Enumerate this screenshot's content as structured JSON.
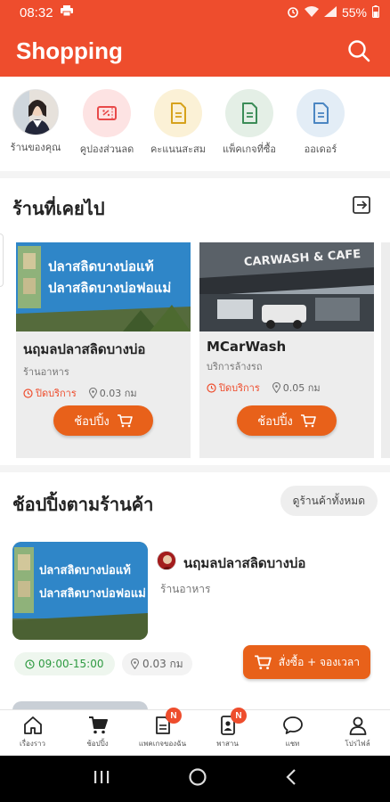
{
  "status_bar": {
    "time": "08:32",
    "battery": "55%"
  },
  "header": {
    "title": "Shopping"
  },
  "quick_menu": [
    {
      "label": "ร้านของคุณ",
      "icon": "store-avatar"
    },
    {
      "label": "คูปองส่วนลด",
      "icon": "coupon-icon",
      "bg": "#fde3e3",
      "color": "#e84a4a"
    },
    {
      "label": "คะแนนสะสม",
      "icon": "points-document-icon",
      "bg": "#fbf1d6",
      "color": "#d6a21c"
    },
    {
      "label": "แพ็คเกจที่ซื้อ",
      "icon": "package-document-icon",
      "bg": "#e4efe6",
      "color": "#3b8c57"
    },
    {
      "label": "ออเดอร์",
      "icon": "order-document-icon",
      "bg": "#e3edf6",
      "color": "#4b86c2"
    }
  ],
  "recent_shops": {
    "title": "ร้านที่เคยไป",
    "items": [
      {
        "name": "นฤมลปลาสลิดบางบ่อ",
        "category": "ร้านอาหาร",
        "status": "ปิดบริการ",
        "distance": "0.03 กม",
        "button": "ช้อปปิ้ง"
      },
      {
        "name": "MCarWash",
        "category": "บริการล้างรถ",
        "status": "ปิดบริการ",
        "distance": "0.05 กม",
        "button": "ช้อปปิ้ง"
      }
    ],
    "banner_lines": [
      "ปลาสลิดบางบ่อแท้",
      "ปลาสลิดบางบ่อฟอแม่"
    ],
    "carwash_sign": "CARWASH & CAFE"
  },
  "shop_by_store": {
    "title": "ช้อปปิ้งตามร้านค้า",
    "all_button": "ดูร้านค้าทั้งหมด",
    "store": {
      "name": "นฤมลปลาสลิดบางบ่อ",
      "category": "ร้านอาหาร",
      "hours": "09:00-15:00",
      "distance": "0.03 กม",
      "order_button": "สั่งซื้อ + จองเวลา"
    }
  },
  "bottom_nav": [
    {
      "label": "เรื่องราว",
      "icon": "home-icon"
    },
    {
      "label": "ช้อปปิ้ง",
      "icon": "cart-icon"
    },
    {
      "label": "แพคเกจของฉัน",
      "icon": "package-icon",
      "badge": "N"
    },
    {
      "label": "พาสาน",
      "icon": "contact-card-icon",
      "badge": "N"
    },
    {
      "label": "แชท",
      "icon": "chat-icon"
    },
    {
      "label": "โปรไฟล์",
      "icon": "profile-icon"
    }
  ],
  "colors": {
    "brand": "#ee4d2d",
    "button": "#e8611a",
    "open": "#2e9a41"
  }
}
